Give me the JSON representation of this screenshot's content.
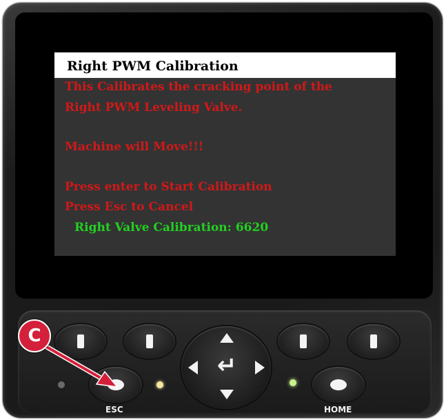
{
  "screen": {
    "title": "Right PWM Calibration",
    "lines": [
      " This Calibrates the cracking point of the",
      "Right PWM Leveling Valve.",
      "Machine will Move!!!",
      "Press enter to Start Calibration",
      "Press Esc to Cancel"
    ],
    "status": "Right Valve Calibration: 6620",
    "colors": {
      "message": "#d21818",
      "status": "#22d022",
      "title_bar": "#ffffff"
    }
  },
  "keypad": {
    "esc_label": "ESC",
    "home_label": "HOME",
    "icons": {
      "softkeys": "softkey-bar-icon",
      "dpad": [
        "arrow-up-icon",
        "arrow-down-icon",
        "arrow-left-icon",
        "arrow-right-icon"
      ],
      "enter": "enter-icon"
    }
  },
  "annotation": {
    "marker": "C",
    "color": "#d4203a"
  }
}
